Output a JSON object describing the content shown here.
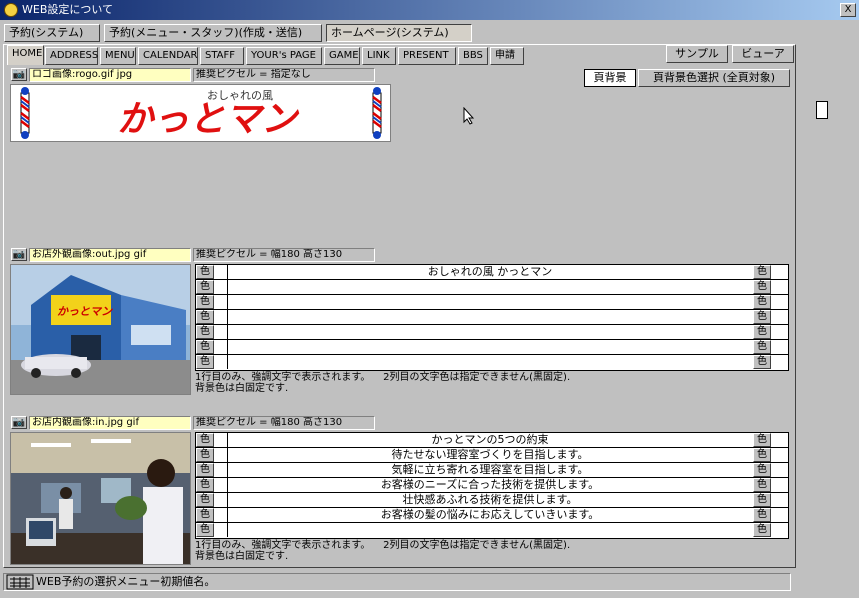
{
  "window": {
    "title": "WEB設定について",
    "close_label": "X"
  },
  "top_tabs": [
    {
      "label": "予約(システム)",
      "selected": false
    },
    {
      "label": "予約(メニュー・スタッフ)(作成・送信)",
      "selected": false
    },
    {
      "label": "ホームページ(システム)",
      "selected": true
    }
  ],
  "sub_tabs": [
    {
      "label": "HOME",
      "selected": true
    },
    {
      "label": "ADDRESS"
    },
    {
      "label": "MENU"
    },
    {
      "label": "CALENDAR"
    },
    {
      "label": "STAFF"
    },
    {
      "label": "YOUR's PAGE"
    },
    {
      "label": "GAME"
    },
    {
      "label": "LINK"
    },
    {
      "label": "PRESENT"
    },
    {
      "label": "BBS"
    },
    {
      "label": "申請"
    }
  ],
  "buttons": {
    "sample": "サンプル",
    "viewer": "ビューア",
    "page_bg": "頁背景",
    "page_bg_color": "頁背景色選択 (全頁対象)"
  },
  "logo": {
    "file_label": "ロゴ画像:rogo.gif jpg",
    "pixel_label": "推奨ピクセル = 指定なし",
    "small_text": "おしゃれの風",
    "big_text": "かっとマン"
  },
  "exterior": {
    "file_label": "お店外観画像:out.jpg gif",
    "pixel_label": "推奨ピクセル = 幅180 高さ130",
    "sign_text": "かっとマン",
    "rows": [
      "おしゃれの風 かっとマン",
      "",
      "",
      "",
      "",
      "",
      ""
    ],
    "note": "1行目のみ、強調文字で表示されます。    2列目の文字色は指定できません(黒固定).\n背景色は白固定です."
  },
  "interior": {
    "file_label": "お店内観画像:in.jpg gif",
    "pixel_label": "推奨ピクセル = 幅180 高さ130",
    "rows": [
      "かっとマンの5つの約束",
      "待たせない理容室づくりを目指します。",
      "気軽に立ち寄れる理容室を目指します。",
      "お客様のニーズに合った技術を提供します。",
      "壮快感あふれる技術を提供します。",
      "お客様の髪の悩みにお応えしていきいます。",
      ""
    ],
    "note": "1行目のみ、強調文字で表示されます。    2列目の文字色は指定できません(黒固定).\n背景色は白固定です."
  },
  "color_button_label": "色",
  "camera_icon_label": "📷",
  "status": {
    "text": "WEB予約の選択メニュー初期値名。"
  }
}
